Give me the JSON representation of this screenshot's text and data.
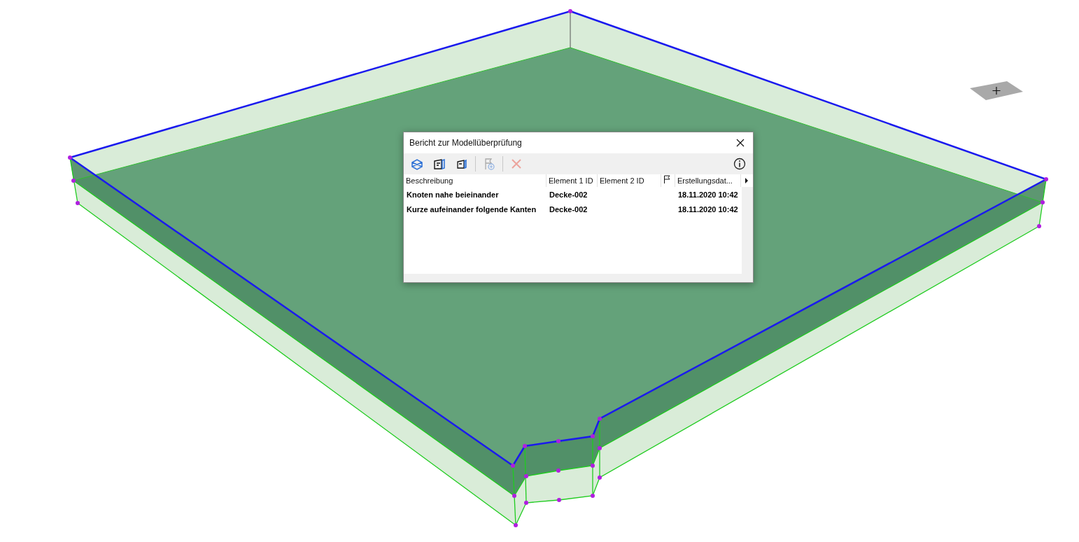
{
  "dialog": {
    "title": "Bericht zur Modellüberprüfung",
    "toolbar": [
      {
        "kind": "zoom-model",
        "disabled": false
      },
      {
        "kind": "select-first",
        "disabled": false
      },
      {
        "kind": "select-second",
        "disabled": false
      },
      {
        "kind": "separator"
      },
      {
        "kind": "add-flag",
        "disabled": true
      },
      {
        "kind": "separator"
      },
      {
        "kind": "delete",
        "disabled": true
      },
      {
        "kind": "info",
        "disabled": false
      }
    ],
    "columns": [
      {
        "kind": "text",
        "label": "Beschreibung"
      },
      {
        "kind": "text",
        "label": "Element 1 ID"
      },
      {
        "kind": "text",
        "label": "Element 2 ID"
      },
      {
        "kind": "flag"
      },
      {
        "kind": "text",
        "label": "Erstellungsdat..."
      }
    ],
    "rows": [
      {
        "description": "Knoten nahe beieinander",
        "element_1_id": "Decke-002",
        "created": "18.11.2020 10:42"
      },
      {
        "description": "Kurze aufeinander folgende Kanten",
        "element_1_id": "Decke-002",
        "created": "18.11.2020 10:42"
      }
    ]
  }
}
